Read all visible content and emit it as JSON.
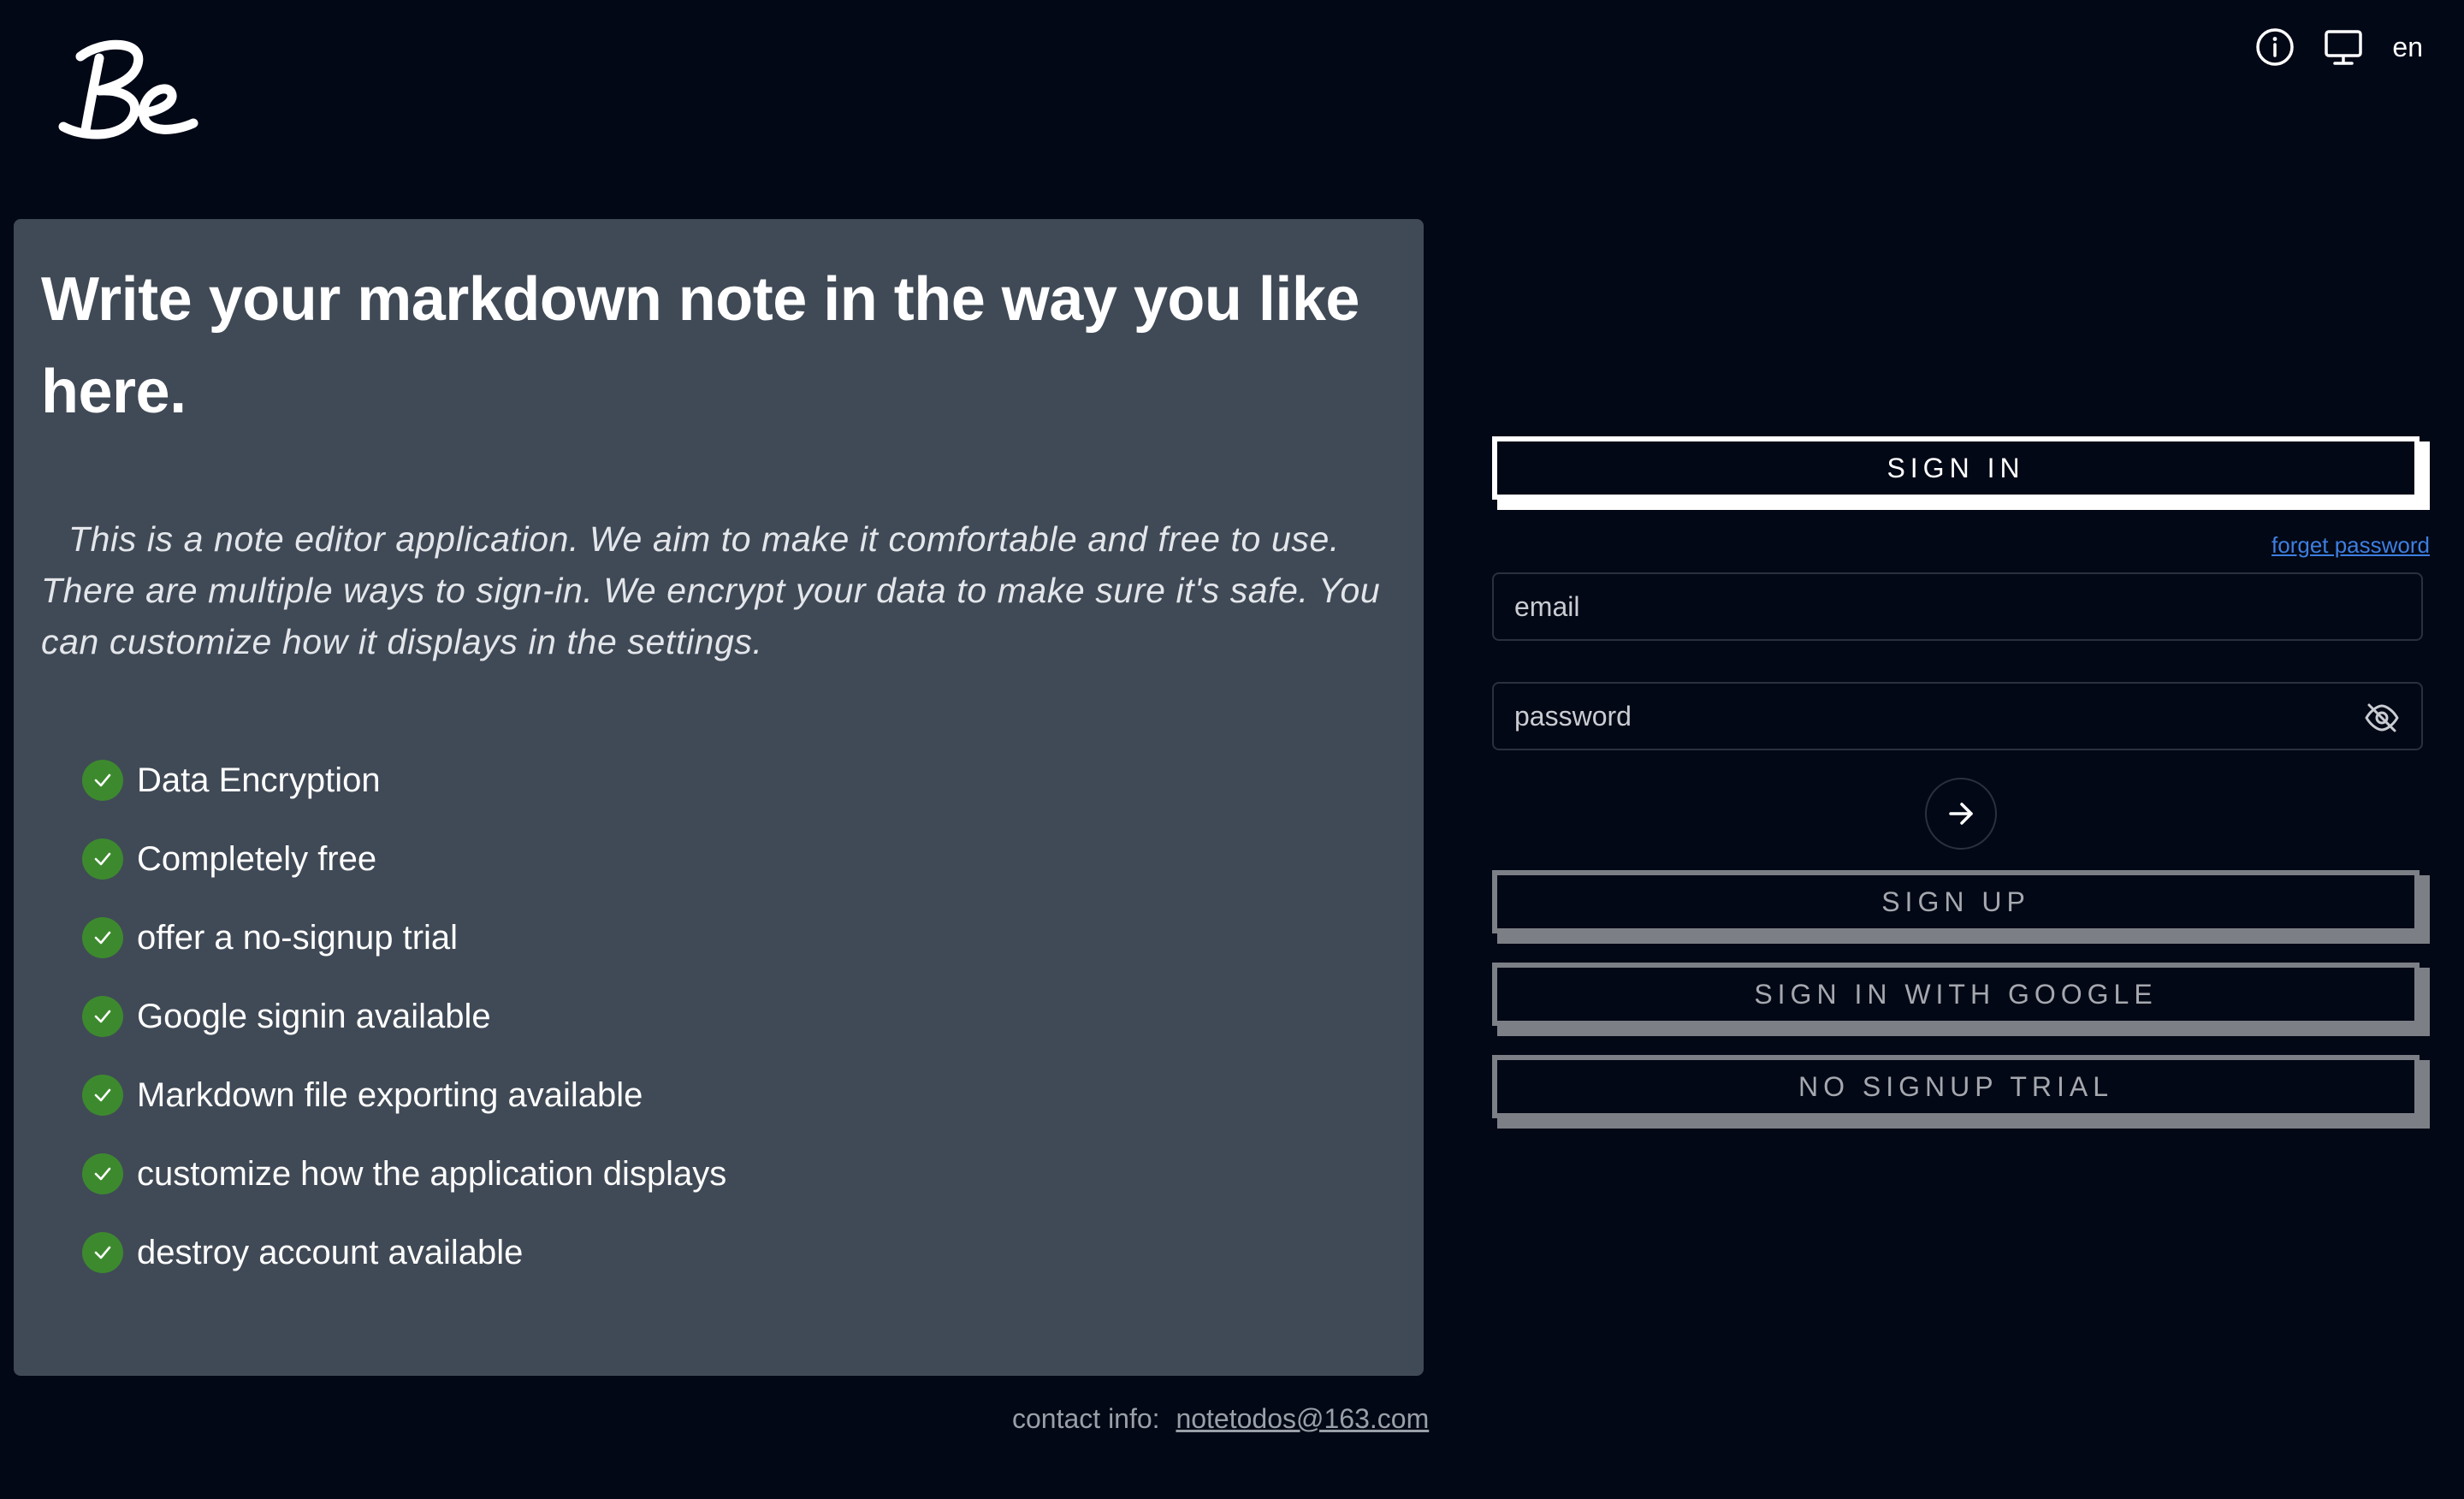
{
  "header": {
    "logo_text": "Be",
    "info_icon": "info-icon",
    "display_icon": "monitor-icon",
    "language": "en"
  },
  "intro": {
    "headline": "Write your markdown note in the way you like here.",
    "description": "This is a note editor application. We aim to make it comfortable and free to use. There are multiple ways to sign-in. We encrypt your data to make sure it's safe. You can customize how it displays in the settings.",
    "features": [
      {
        "label": "Data Encryption",
        "icon": "check-icon"
      },
      {
        "label": "Completely free",
        "icon": "check-icon"
      },
      {
        "label": "offer a no-signup trial",
        "icon": "check-icon"
      },
      {
        "label": "Google signin available",
        "icon": "check-icon"
      },
      {
        "label": "Markdown file exporting available",
        "icon": "check-icon"
      },
      {
        "label": "customize how the application displays",
        "icon": "check-icon"
      },
      {
        "label": "destroy account available",
        "icon": "check-icon"
      }
    ]
  },
  "auth": {
    "sign_in_label": "SIGN IN",
    "forget_password": "forget password",
    "email_placeholder": "email",
    "password_placeholder": "password",
    "sign_up_label": "SIGN UP",
    "google_label": "SIGN IN WITH GOOGLE",
    "trial_label": "NO SIGNUP TRIAL"
  },
  "footer": {
    "contact_label": "contact info:",
    "contact_email": "notetodos@163.com"
  },
  "colors": {
    "background": "#030816",
    "card": "#404a56",
    "check": "#3d8a2e",
    "link": "#3d7fe0"
  }
}
